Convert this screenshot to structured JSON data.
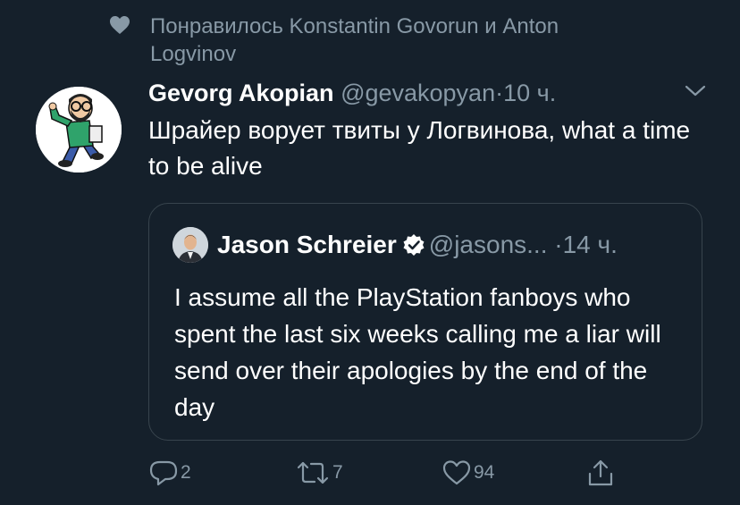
{
  "social_context": {
    "icon": "heart-icon",
    "text": "Понравилось Konstantin Govorun и Anton Logvinov"
  },
  "tweet": {
    "author_name": "Gevorg Akopian",
    "handle": "@gevakopyan",
    "separator": "·",
    "time": "10 ч.",
    "text": "Шрайер ворует твиты у Логвинова, what a time to be alive"
  },
  "quoted_tweet": {
    "author_name": "Jason Schreier",
    "handle": "@jasons...",
    "separator": "·",
    "time": "14 ч.",
    "text": "I assume all the PlayStation fanboys who spent the last six weeks calling me a liar will send over their apologies by the end of the day"
  },
  "actions": {
    "reply_count": "2",
    "retweet_count": "7",
    "like_count": "94"
  },
  "colors": {
    "background": "#15202b",
    "muted": "#8899a6",
    "border": "#38444d",
    "text": "#ffffff"
  }
}
